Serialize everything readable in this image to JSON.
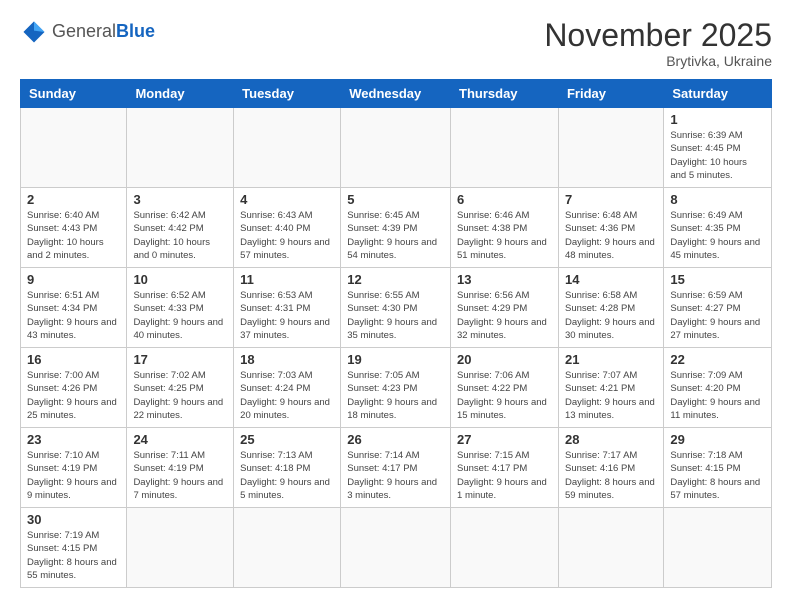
{
  "logo": {
    "general": "General",
    "blue": "Blue"
  },
  "title": {
    "month_year": "November 2025",
    "location": "Brytivka, Ukraine"
  },
  "weekdays": [
    "Sunday",
    "Monday",
    "Tuesday",
    "Wednesday",
    "Thursday",
    "Friday",
    "Saturday"
  ],
  "weeks": [
    [
      {
        "day": "",
        "info": ""
      },
      {
        "day": "",
        "info": ""
      },
      {
        "day": "",
        "info": ""
      },
      {
        "day": "",
        "info": ""
      },
      {
        "day": "",
        "info": ""
      },
      {
        "day": "",
        "info": ""
      },
      {
        "day": "1",
        "info": "Sunrise: 6:39 AM\nSunset: 4:45 PM\nDaylight: 10 hours and 5 minutes."
      }
    ],
    [
      {
        "day": "2",
        "info": "Sunrise: 6:40 AM\nSunset: 4:43 PM\nDaylight: 10 hours and 2 minutes."
      },
      {
        "day": "3",
        "info": "Sunrise: 6:42 AM\nSunset: 4:42 PM\nDaylight: 10 hours and 0 minutes."
      },
      {
        "day": "4",
        "info": "Sunrise: 6:43 AM\nSunset: 4:40 PM\nDaylight: 9 hours and 57 minutes."
      },
      {
        "day": "5",
        "info": "Sunrise: 6:45 AM\nSunset: 4:39 PM\nDaylight: 9 hours and 54 minutes."
      },
      {
        "day": "6",
        "info": "Sunrise: 6:46 AM\nSunset: 4:38 PM\nDaylight: 9 hours and 51 minutes."
      },
      {
        "day": "7",
        "info": "Sunrise: 6:48 AM\nSunset: 4:36 PM\nDaylight: 9 hours and 48 minutes."
      },
      {
        "day": "8",
        "info": "Sunrise: 6:49 AM\nSunset: 4:35 PM\nDaylight: 9 hours and 45 minutes."
      }
    ],
    [
      {
        "day": "9",
        "info": "Sunrise: 6:51 AM\nSunset: 4:34 PM\nDaylight: 9 hours and 43 minutes."
      },
      {
        "day": "10",
        "info": "Sunrise: 6:52 AM\nSunset: 4:33 PM\nDaylight: 9 hours and 40 minutes."
      },
      {
        "day": "11",
        "info": "Sunrise: 6:53 AM\nSunset: 4:31 PM\nDaylight: 9 hours and 37 minutes."
      },
      {
        "day": "12",
        "info": "Sunrise: 6:55 AM\nSunset: 4:30 PM\nDaylight: 9 hours and 35 minutes."
      },
      {
        "day": "13",
        "info": "Sunrise: 6:56 AM\nSunset: 4:29 PM\nDaylight: 9 hours and 32 minutes."
      },
      {
        "day": "14",
        "info": "Sunrise: 6:58 AM\nSunset: 4:28 PM\nDaylight: 9 hours and 30 minutes."
      },
      {
        "day": "15",
        "info": "Sunrise: 6:59 AM\nSunset: 4:27 PM\nDaylight: 9 hours and 27 minutes."
      }
    ],
    [
      {
        "day": "16",
        "info": "Sunrise: 7:00 AM\nSunset: 4:26 PM\nDaylight: 9 hours and 25 minutes."
      },
      {
        "day": "17",
        "info": "Sunrise: 7:02 AM\nSunset: 4:25 PM\nDaylight: 9 hours and 22 minutes."
      },
      {
        "day": "18",
        "info": "Sunrise: 7:03 AM\nSunset: 4:24 PM\nDaylight: 9 hours and 20 minutes."
      },
      {
        "day": "19",
        "info": "Sunrise: 7:05 AM\nSunset: 4:23 PM\nDaylight: 9 hours and 18 minutes."
      },
      {
        "day": "20",
        "info": "Sunrise: 7:06 AM\nSunset: 4:22 PM\nDaylight: 9 hours and 15 minutes."
      },
      {
        "day": "21",
        "info": "Sunrise: 7:07 AM\nSunset: 4:21 PM\nDaylight: 9 hours and 13 minutes."
      },
      {
        "day": "22",
        "info": "Sunrise: 7:09 AM\nSunset: 4:20 PM\nDaylight: 9 hours and 11 minutes."
      }
    ],
    [
      {
        "day": "23",
        "info": "Sunrise: 7:10 AM\nSunset: 4:19 PM\nDaylight: 9 hours and 9 minutes."
      },
      {
        "day": "24",
        "info": "Sunrise: 7:11 AM\nSunset: 4:19 PM\nDaylight: 9 hours and 7 minutes."
      },
      {
        "day": "25",
        "info": "Sunrise: 7:13 AM\nSunset: 4:18 PM\nDaylight: 9 hours and 5 minutes."
      },
      {
        "day": "26",
        "info": "Sunrise: 7:14 AM\nSunset: 4:17 PM\nDaylight: 9 hours and 3 minutes."
      },
      {
        "day": "27",
        "info": "Sunrise: 7:15 AM\nSunset: 4:17 PM\nDaylight: 9 hours and 1 minute."
      },
      {
        "day": "28",
        "info": "Sunrise: 7:17 AM\nSunset: 4:16 PM\nDaylight: 8 hours and 59 minutes."
      },
      {
        "day": "29",
        "info": "Sunrise: 7:18 AM\nSunset: 4:15 PM\nDaylight: 8 hours and 57 minutes."
      }
    ],
    [
      {
        "day": "30",
        "info": "Sunrise: 7:19 AM\nSunset: 4:15 PM\nDaylight: 8 hours and 55 minutes."
      },
      {
        "day": "",
        "info": ""
      },
      {
        "day": "",
        "info": ""
      },
      {
        "day": "",
        "info": ""
      },
      {
        "day": "",
        "info": ""
      },
      {
        "day": "",
        "info": ""
      },
      {
        "day": "",
        "info": ""
      }
    ]
  ]
}
